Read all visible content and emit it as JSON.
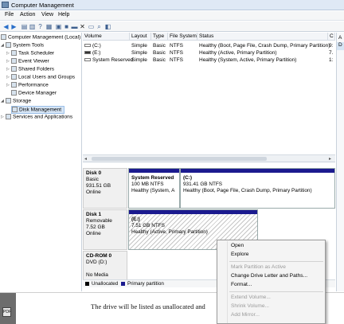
{
  "window": {
    "title": "Computer Management"
  },
  "menu": [
    "File",
    "Action",
    "View",
    "Help"
  ],
  "toolbar": {
    "icons": [
      "back-icon",
      "forward-icon",
      "up-icon",
      "show-hide-tree-icon",
      "help-icon",
      "console-icon",
      "disk-icon",
      "properties-icon",
      "delete-icon",
      "export-icon",
      "folder-icon",
      "search-icon",
      "refresh-icon"
    ]
  },
  "tree": {
    "root": "Computer Management (Local)",
    "items": [
      {
        "label": "System Tools"
      },
      {
        "label": "Task Scheduler"
      },
      {
        "label": "Event Viewer"
      },
      {
        "label": "Shared Folders"
      },
      {
        "label": "Local Users and Groups"
      },
      {
        "label": "Performance"
      },
      {
        "label": "Device Manager"
      },
      {
        "label": "Storage"
      },
      {
        "label": "Disk Management"
      },
      {
        "label": "Services and Applications"
      }
    ]
  },
  "volumes": {
    "columns": [
      "Volume",
      "Layout",
      "Type",
      "File System",
      "Status"
    ],
    "rows": [
      {
        "volume": "(C:)",
        "layout": "Simple",
        "type": "Basic",
        "fs": "NTFS",
        "status": "Healthy (Boot, Page File, Crash Dump, Primary Partition)",
        "extra": "9:"
      },
      {
        "volume": "(E:)",
        "layout": "Simple",
        "type": "Basic",
        "fs": "NTFS",
        "status": "Healthy (Active, Primary Partition)",
        "extra": "7."
      },
      {
        "volume": "System Reserved",
        "layout": "Simple",
        "type": "Basic",
        "fs": "NTFS",
        "status": "Healthy (System, Active, Primary Partition)",
        "extra": "1:"
      }
    ]
  },
  "actions": {
    "header": "A",
    "col_partial": "C",
    "item": "D"
  },
  "disks": [
    {
      "name": "Disk 0",
      "type": "Basic",
      "size": "931.51 GB",
      "state": "Online",
      "partitions": [
        {
          "name": "System Reserved",
          "size": "100 MB NTFS",
          "status": "Healthy (System, A"
        },
        {
          "name": "(C:)",
          "size": "931.41 GB NTFS",
          "status": "Healthy (Boot, Page File, Crash Dump, Primary Partition)"
        }
      ]
    },
    {
      "name": "Disk 1",
      "type": "Removable",
      "size": "7.52 GB",
      "state": "Online",
      "partitions": [
        {
          "name": "(E:)",
          "size": "7.51 GB NTFS",
          "status": "Healthy (Active, Primary Partition)"
        }
      ]
    },
    {
      "name": "CD-ROM 0",
      "type": "DVD (D:)",
      "size": "",
      "state": "No Media"
    }
  ],
  "legend": {
    "unallocated": "Unallocated",
    "primary": "Primary partition",
    "unallocated_color": "#000000",
    "primary_color": "#1b1a8f"
  },
  "context_menu": {
    "items": [
      {
        "label": "Open",
        "enabled": true
      },
      {
        "label": "Explore",
        "enabled": true
      },
      {
        "label": "Mark Partition as Active",
        "enabled": false
      },
      {
        "label": "Change Drive Letter and Paths...",
        "enabled": true
      },
      {
        "label": "Format...",
        "enabled": true
      },
      {
        "label": "Extend Volume...",
        "enabled": false
      },
      {
        "label": "Shrink Volume...",
        "enabled": false
      },
      {
        "label": "Add Mirror...",
        "enabled": false
      }
    ]
  },
  "document": {
    "text": "The drive will be listed as unallocated and"
  }
}
